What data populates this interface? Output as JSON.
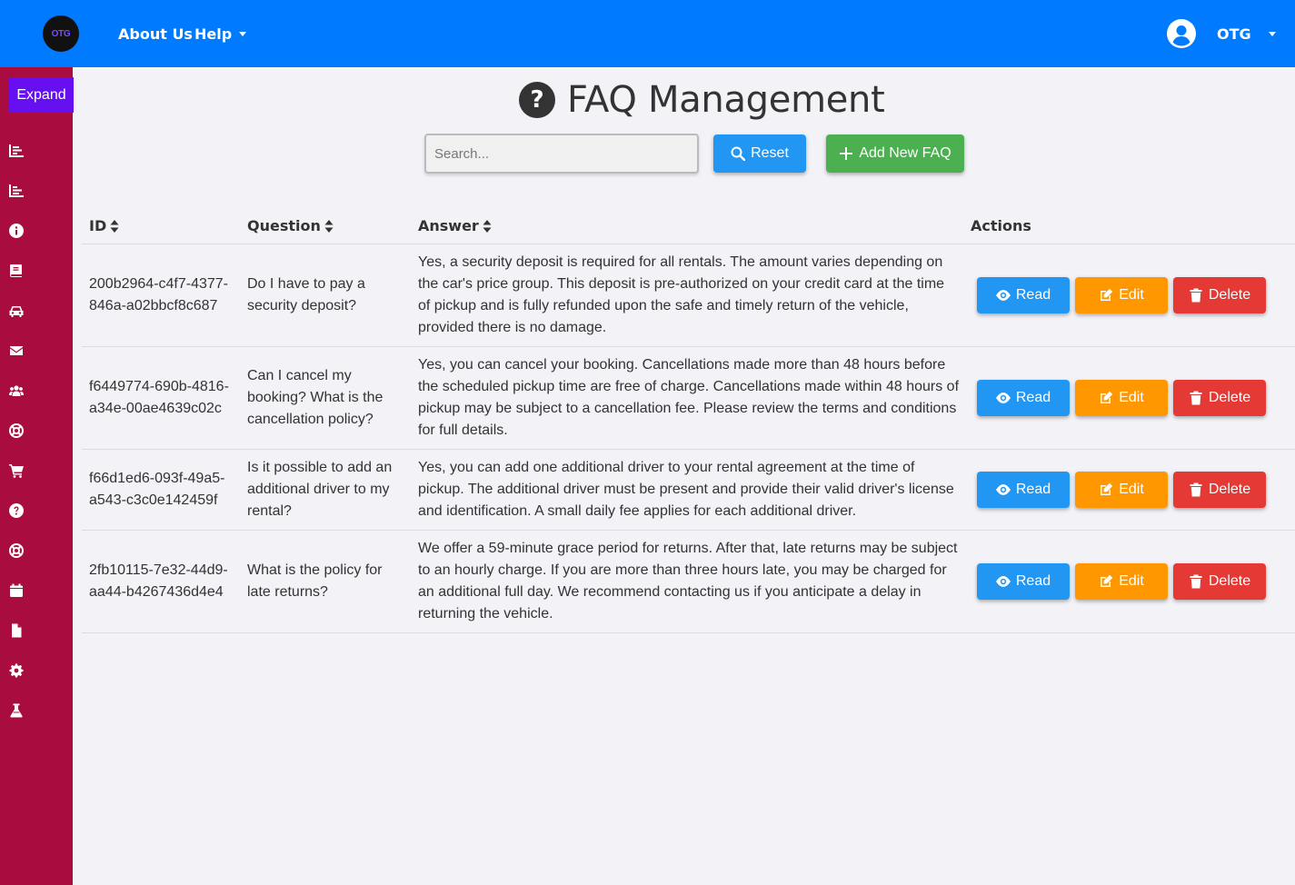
{
  "navbar": {
    "logo_text": "OTG",
    "links": [
      {
        "label": "About Us"
      },
      {
        "label": "Help"
      }
    ],
    "user": {
      "name": "OTG"
    }
  },
  "sidebar": {
    "expand_label": "Expand",
    "icons": [
      "chart-bar-icon",
      "chart-bar-icon",
      "info-circle-icon",
      "book-icon",
      "car-icon",
      "envelope-icon",
      "users-icon",
      "life-ring-icon",
      "shopping-cart-icon",
      "question-circle-icon",
      "life-ring-icon",
      "calendar-icon",
      "file-icon",
      "gear-icon",
      "flask-icon"
    ]
  },
  "page": {
    "title": "FAQ Management",
    "title_icon": "?",
    "search_placeholder": "Search...",
    "reset_label": "Reset",
    "add_label": "Add New FAQ"
  },
  "table": {
    "headers": {
      "id": "ID",
      "question": "Question",
      "answer": "Answer",
      "actions": "Actions"
    },
    "actions": {
      "read": "Read",
      "edit": "Edit",
      "delete": "Delete"
    },
    "rows": [
      {
        "id": "200b2964-c4f7-4377-846a-a02bbcf8c687",
        "question": "Do I have to pay a security deposit?",
        "answer": "Yes, a security deposit is required for all rentals. The amount varies depending on the car's price group. This deposit is pre-authorized on your credit card at the time of pickup and is fully refunded upon the safe and timely return of the vehicle, provided there is no damage."
      },
      {
        "id": "f6449774-690b-4816-a34e-00ae4639c02c",
        "question": "Can I cancel my booking? What is the cancellation policy?",
        "answer": "Yes, you can cancel your booking. Cancellations made more than 48 hours before the scheduled pickup time are free of charge. Cancellations made within 48 hours of pickup may be subject to a cancellation fee. Please review the terms and conditions for full details."
      },
      {
        "id": "f66d1ed6-093f-49a5-a543-c3c0e142459f",
        "question": "Is it possible to add an additional driver to my rental?",
        "answer": "Yes, you can add one additional driver to your rental agreement at the time of pickup. The additional driver must be present and provide their valid driver's license and identification. A small daily fee applies for each additional driver."
      },
      {
        "id": "2fb10115-7e32-44d9-aa44-b4267436d4e4",
        "question": "What is the policy for late returns?",
        "answer": "We offer a 59-minute grace period for returns. After that, late returns may be subject to an hourly charge. If you are more than three hours late, you may be charged for an additional full day. We recommend contacting us if you anticipate a delay in returning the vehicle."
      }
    ]
  },
  "colors": {
    "navbar": "#007bff",
    "sidebar": "#a90c3e",
    "expand": "#6610f2",
    "read": "#2196f3",
    "edit": "#ff9800",
    "delete": "#e53935",
    "add": "#4caf50"
  }
}
